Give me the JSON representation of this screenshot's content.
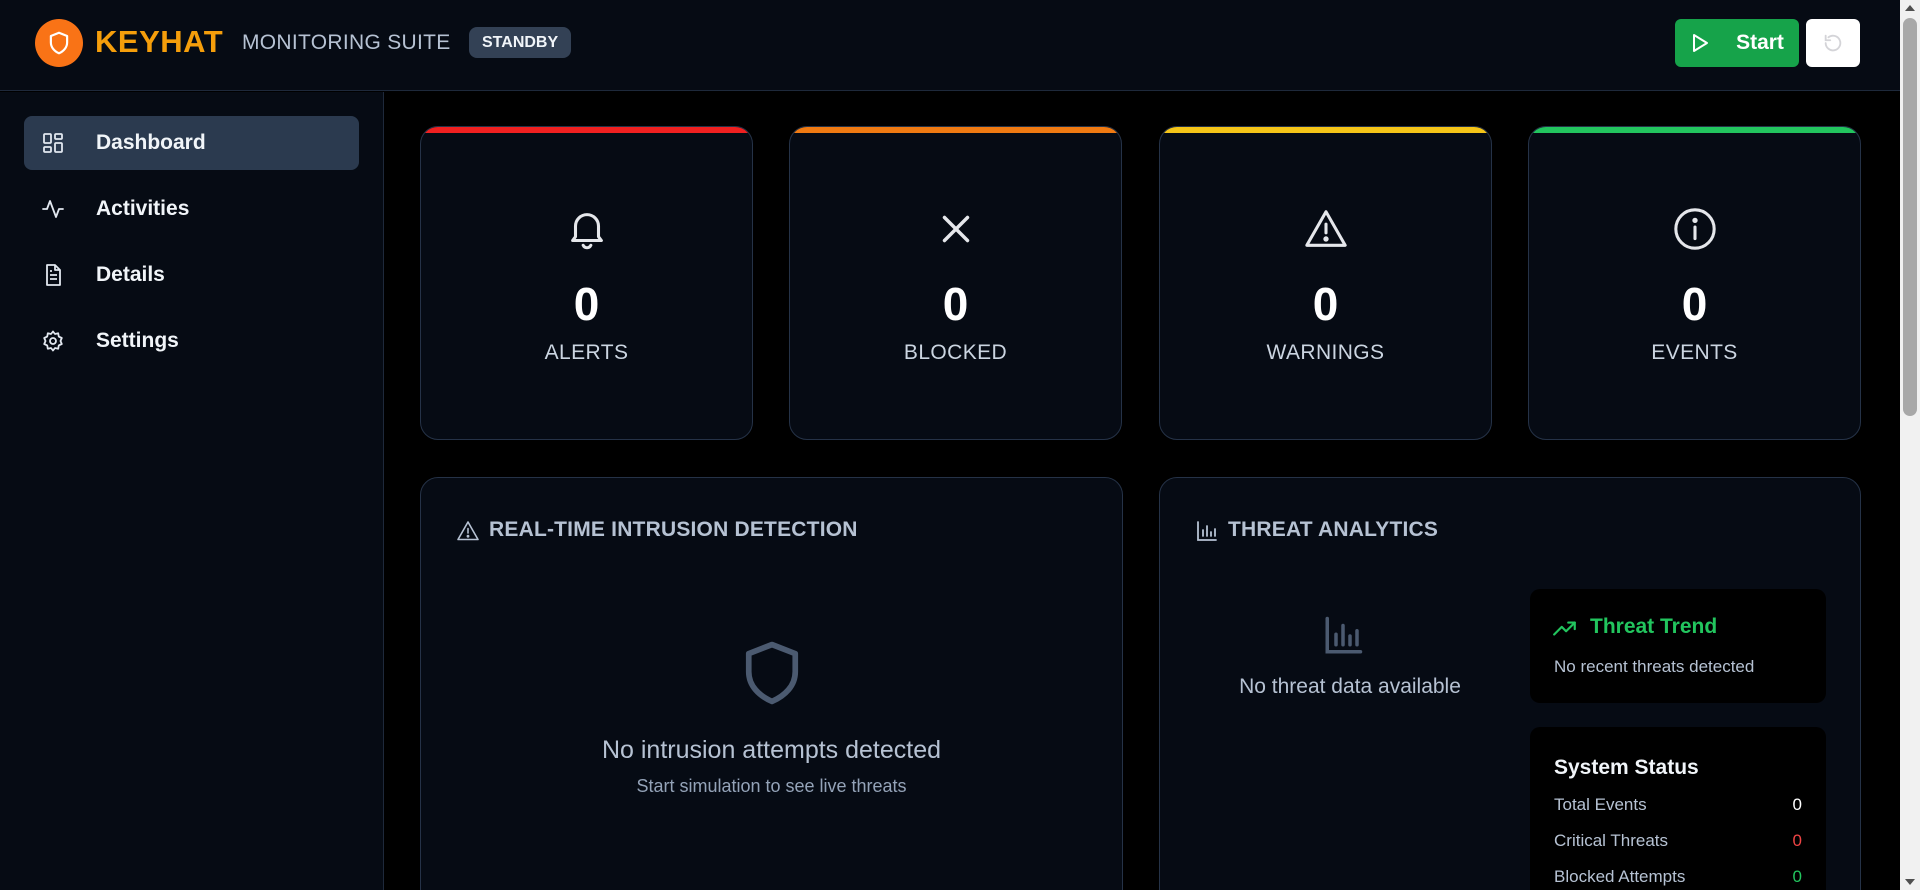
{
  "header": {
    "brand": "KEYHAT",
    "suite": "MONITORING SUITE",
    "status": "STANDBY",
    "start_label": "Start"
  },
  "sidebar": {
    "items": [
      {
        "label": "Dashboard",
        "icon": "dashboard-icon",
        "active": true
      },
      {
        "label": "Activities",
        "icon": "activity-icon",
        "active": false
      },
      {
        "label": "Details",
        "icon": "document-icon",
        "active": false
      },
      {
        "label": "Settings",
        "icon": "gear-icon",
        "active": false
      }
    ]
  },
  "stats": [
    {
      "value": "0",
      "label": "ALERTS",
      "icon": "bell-icon",
      "color": "#ef2020"
    },
    {
      "value": "0",
      "label": "BLOCKED",
      "icon": "x-icon",
      "color": "#f07a12"
    },
    {
      "value": "0",
      "label": "WARNINGS",
      "icon": "warning-triangle-icon",
      "color": "#f5c518"
    },
    {
      "value": "0",
      "label": "EVENTS",
      "icon": "info-icon",
      "color": "#22c55e"
    }
  ],
  "intrusion": {
    "title": "REAL-TIME INTRUSION DETECTION",
    "empty_title": "No intrusion attempts detected",
    "empty_sub": "Start simulation to see live threats"
  },
  "analytics": {
    "title": "THREAT ANALYTICS",
    "empty_text": "No threat data available",
    "trend_title": "Threat Trend",
    "trend_sub": "No recent threats detected",
    "system_status": {
      "title": "System Status",
      "rows": [
        {
          "label": "Total Events",
          "value": "0",
          "color": "#ffffff"
        },
        {
          "label": "Critical Threats",
          "value": "0",
          "color": "#ef4444"
        },
        {
          "label": "Blocked Attempts",
          "value": "0",
          "color": "#22c55e"
        }
      ]
    }
  },
  "colors": {
    "accent": "#f97316",
    "brand_text": "#f59e0b",
    "start_button": "#16a34a"
  }
}
